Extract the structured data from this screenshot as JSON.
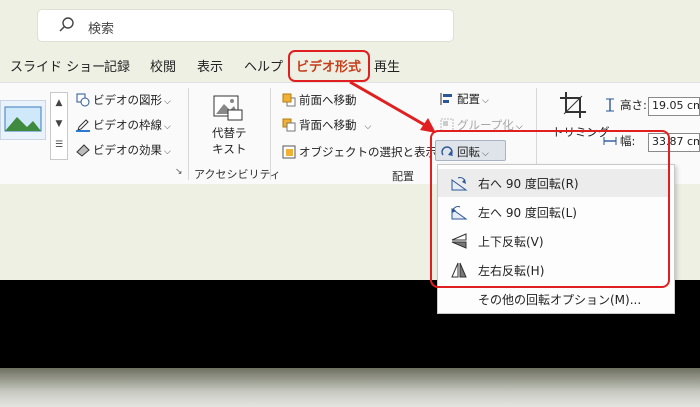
{
  "search": {
    "placeholder": "検索"
  },
  "tabs": [
    {
      "label": "スライド ショー"
    },
    {
      "label": "記録"
    },
    {
      "label": "校閲"
    },
    {
      "label": "表示"
    },
    {
      "label": "ヘルプ"
    },
    {
      "label": "ビデオ形式"
    },
    {
      "label": "再生"
    }
  ],
  "ribbon": {
    "video_shape": "ビデオの図形",
    "video_border": "ビデオの枠線",
    "video_effects": "ビデオの効果",
    "alt_text_line1": "代替テ",
    "alt_text_line2": "キスト",
    "accessibility_group": "アクセシビリティ",
    "bring_forward": "前面へ移動",
    "send_backward": "背面へ移動",
    "selection_pane": "オブジェクトの選択と表示",
    "align": "配置",
    "group": "グループ化",
    "rotate": "回転",
    "arrange_group": "配置",
    "trim": "トリミング",
    "height_label": "高さ:",
    "height_value": "19.05 cm",
    "width_label": "幅:",
    "width_value": "33.87 cm"
  },
  "rotate_menu": {
    "items": [
      {
        "label": "右へ 90 度回転(R)",
        "icon": "rotate-right-icon"
      },
      {
        "label": "左へ 90 度回転(L)",
        "icon": "rotate-left-icon"
      },
      {
        "label": "上下反転(V)",
        "icon": "flip-vertical-icon"
      },
      {
        "label": "左右反転(H)",
        "icon": "flip-horizontal-icon"
      },
      {
        "label": "その他の回転オプション(M)..."
      }
    ]
  },
  "colors": {
    "accent": "#c43e1c",
    "highlight": "#e02020"
  }
}
